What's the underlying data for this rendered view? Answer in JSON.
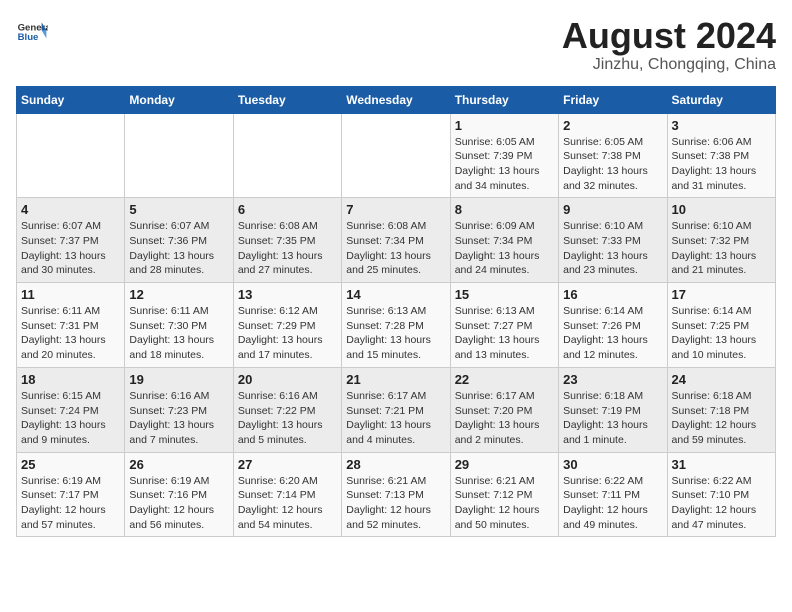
{
  "header": {
    "logo_general": "General",
    "logo_blue": "Blue",
    "title": "August 2024",
    "subtitle": "Jinzhu, Chongqing, China"
  },
  "calendar": {
    "days_of_week": [
      "Sunday",
      "Monday",
      "Tuesday",
      "Wednesday",
      "Thursday",
      "Friday",
      "Saturday"
    ],
    "weeks": [
      [
        {
          "day": "",
          "info": ""
        },
        {
          "day": "",
          "info": ""
        },
        {
          "day": "",
          "info": ""
        },
        {
          "day": "",
          "info": ""
        },
        {
          "day": "1",
          "info": "Sunrise: 6:05 AM\nSunset: 7:39 PM\nDaylight: 13 hours\nand 34 minutes."
        },
        {
          "day": "2",
          "info": "Sunrise: 6:05 AM\nSunset: 7:38 PM\nDaylight: 13 hours\nand 32 minutes."
        },
        {
          "day": "3",
          "info": "Sunrise: 6:06 AM\nSunset: 7:38 PM\nDaylight: 13 hours\nand 31 minutes."
        }
      ],
      [
        {
          "day": "4",
          "info": "Sunrise: 6:07 AM\nSunset: 7:37 PM\nDaylight: 13 hours\nand 30 minutes."
        },
        {
          "day": "5",
          "info": "Sunrise: 6:07 AM\nSunset: 7:36 PM\nDaylight: 13 hours\nand 28 minutes."
        },
        {
          "day": "6",
          "info": "Sunrise: 6:08 AM\nSunset: 7:35 PM\nDaylight: 13 hours\nand 27 minutes."
        },
        {
          "day": "7",
          "info": "Sunrise: 6:08 AM\nSunset: 7:34 PM\nDaylight: 13 hours\nand 25 minutes."
        },
        {
          "day": "8",
          "info": "Sunrise: 6:09 AM\nSunset: 7:34 PM\nDaylight: 13 hours\nand 24 minutes."
        },
        {
          "day": "9",
          "info": "Sunrise: 6:10 AM\nSunset: 7:33 PM\nDaylight: 13 hours\nand 23 minutes."
        },
        {
          "day": "10",
          "info": "Sunrise: 6:10 AM\nSunset: 7:32 PM\nDaylight: 13 hours\nand 21 minutes."
        }
      ],
      [
        {
          "day": "11",
          "info": "Sunrise: 6:11 AM\nSunset: 7:31 PM\nDaylight: 13 hours\nand 20 minutes."
        },
        {
          "day": "12",
          "info": "Sunrise: 6:11 AM\nSunset: 7:30 PM\nDaylight: 13 hours\nand 18 minutes."
        },
        {
          "day": "13",
          "info": "Sunrise: 6:12 AM\nSunset: 7:29 PM\nDaylight: 13 hours\nand 17 minutes."
        },
        {
          "day": "14",
          "info": "Sunrise: 6:13 AM\nSunset: 7:28 PM\nDaylight: 13 hours\nand 15 minutes."
        },
        {
          "day": "15",
          "info": "Sunrise: 6:13 AM\nSunset: 7:27 PM\nDaylight: 13 hours\nand 13 minutes."
        },
        {
          "day": "16",
          "info": "Sunrise: 6:14 AM\nSunset: 7:26 PM\nDaylight: 13 hours\nand 12 minutes."
        },
        {
          "day": "17",
          "info": "Sunrise: 6:14 AM\nSunset: 7:25 PM\nDaylight: 13 hours\nand 10 minutes."
        }
      ],
      [
        {
          "day": "18",
          "info": "Sunrise: 6:15 AM\nSunset: 7:24 PM\nDaylight: 13 hours\nand 9 minutes."
        },
        {
          "day": "19",
          "info": "Sunrise: 6:16 AM\nSunset: 7:23 PM\nDaylight: 13 hours\nand 7 minutes."
        },
        {
          "day": "20",
          "info": "Sunrise: 6:16 AM\nSunset: 7:22 PM\nDaylight: 13 hours\nand 5 minutes."
        },
        {
          "day": "21",
          "info": "Sunrise: 6:17 AM\nSunset: 7:21 PM\nDaylight: 13 hours\nand 4 minutes."
        },
        {
          "day": "22",
          "info": "Sunrise: 6:17 AM\nSunset: 7:20 PM\nDaylight: 13 hours\nand 2 minutes."
        },
        {
          "day": "23",
          "info": "Sunrise: 6:18 AM\nSunset: 7:19 PM\nDaylight: 13 hours\nand 1 minute."
        },
        {
          "day": "24",
          "info": "Sunrise: 6:18 AM\nSunset: 7:18 PM\nDaylight: 12 hours\nand 59 minutes."
        }
      ],
      [
        {
          "day": "25",
          "info": "Sunrise: 6:19 AM\nSunset: 7:17 PM\nDaylight: 12 hours\nand 57 minutes."
        },
        {
          "day": "26",
          "info": "Sunrise: 6:19 AM\nSunset: 7:16 PM\nDaylight: 12 hours\nand 56 minutes."
        },
        {
          "day": "27",
          "info": "Sunrise: 6:20 AM\nSunset: 7:14 PM\nDaylight: 12 hours\nand 54 minutes."
        },
        {
          "day": "28",
          "info": "Sunrise: 6:21 AM\nSunset: 7:13 PM\nDaylight: 12 hours\nand 52 minutes."
        },
        {
          "day": "29",
          "info": "Sunrise: 6:21 AM\nSunset: 7:12 PM\nDaylight: 12 hours\nand 50 minutes."
        },
        {
          "day": "30",
          "info": "Sunrise: 6:22 AM\nSunset: 7:11 PM\nDaylight: 12 hours\nand 49 minutes."
        },
        {
          "day": "31",
          "info": "Sunrise: 6:22 AM\nSunset: 7:10 PM\nDaylight: 12 hours\nand 47 minutes."
        }
      ]
    ]
  }
}
